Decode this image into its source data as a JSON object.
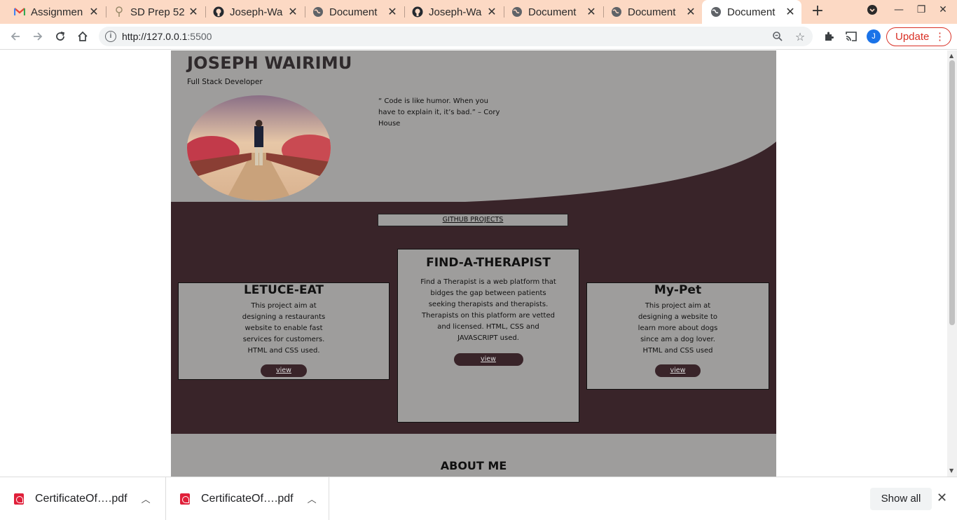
{
  "browser": {
    "tabs": [
      {
        "label": "Assignmen",
        "icon": "gmail-icon"
      },
      {
        "label": "SD Prep 52",
        "icon": "sd-prep-icon"
      },
      {
        "label": "Joseph-Wa",
        "icon": "github-icon"
      },
      {
        "label": "Document",
        "icon": "globe-icon"
      },
      {
        "label": "Joseph-Wa",
        "icon": "github-icon"
      },
      {
        "label": "Document",
        "icon": "globe-icon"
      },
      {
        "label": "Document",
        "icon": "globe-icon"
      },
      {
        "label": "Document",
        "icon": "globe-icon",
        "active": true
      }
    ],
    "url_host": "http://127.0.0.1",
    "url_port": ":5500",
    "update_label": "Update",
    "profile_initial": "J"
  },
  "page": {
    "name": "JOSEPH WAIRIMU",
    "role": "Full Stack Developer",
    "quote": "“ Code is like humor. When you have to explain it, it’s bad.” – Cory House",
    "github_link": "GITHUB PROJECTS",
    "projects": [
      {
        "title": "LETUCE-EAT",
        "description": "This project aim at designing a restaurants website to enable fast services for customers. HTML and CSS used.",
        "button": "view"
      },
      {
        "title": "FIND-A-THERAPIST",
        "description": "Find a Therapist is a web platform that bidges the gap between patients seeking therapists and therapists. Therapists on this platform are vetted and licensed. HTML, CSS and JAVASCRIPT used.",
        "button": "view"
      },
      {
        "title": "My-Pet",
        "description": "This project aim at designing a website to learn more about dogs since am a dog lover. HTML and CSS used",
        "button": "view"
      }
    ],
    "about_heading": "ABOUT ME"
  },
  "downloads": {
    "items": [
      "CertificateOf….pdf",
      "CertificateOf….pdf"
    ],
    "show_all": "Show all"
  },
  "colors": {
    "tab_strip": "#fcd9c4",
    "page_gray": "#9e9d9c",
    "page_dark": "#392429",
    "update_red": "#d93025"
  }
}
